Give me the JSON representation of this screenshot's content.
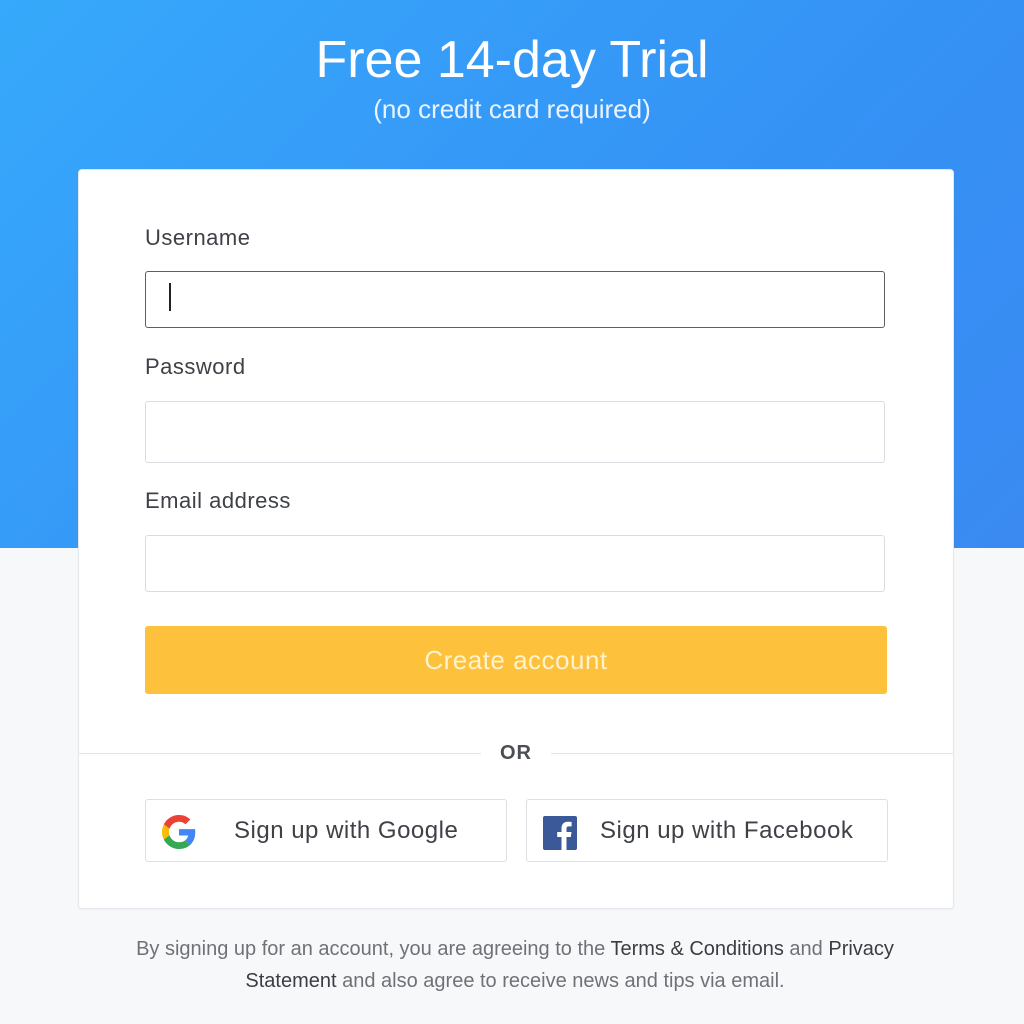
{
  "header": {
    "title": "Free 14-day Trial",
    "subtitle": "(no credit card required)"
  },
  "form": {
    "username_label": "Username",
    "username_value": "",
    "password_label": "Password",
    "password_value": "",
    "email_label": "Email address",
    "email_value": "",
    "create_button": "Create account",
    "divider": "OR"
  },
  "social": {
    "google_label": "Sign up with Google",
    "google_icon": "google-logo-icon",
    "facebook_label": "Sign up with Facebook",
    "facebook_icon": "facebook-logo-icon"
  },
  "footer": {
    "text_1": "By signing up for an account, you are agreeing to the ",
    "terms_link": "Terms & Conditions",
    "text_2": " and ",
    "privacy_link": "Privacy Statement",
    "text_3": " and also agree to receive news and tips via email."
  },
  "colors": {
    "hero_blue": "#3592f5",
    "button_yellow": "#fdc13b",
    "facebook_blue": "#3b5998"
  }
}
